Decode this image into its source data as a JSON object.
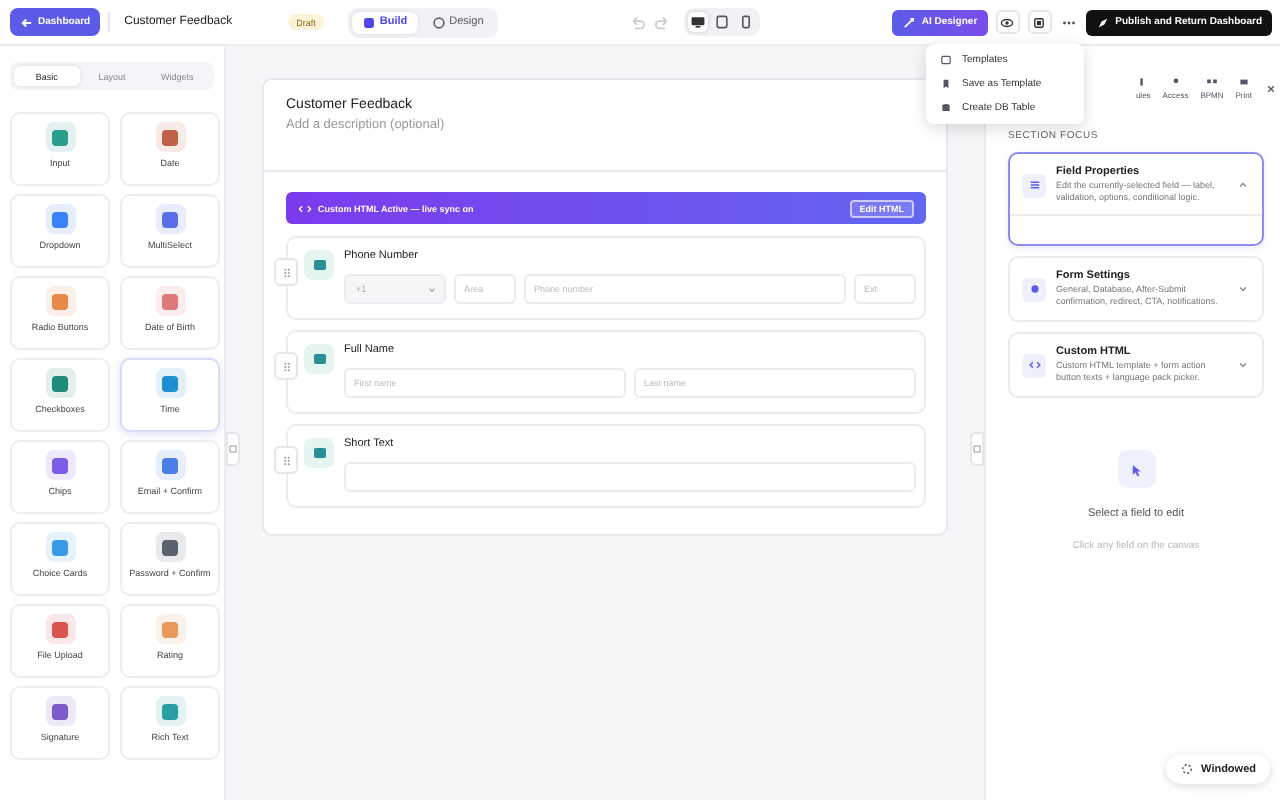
{
  "topbar": {
    "back_button": "Dashboard",
    "form_name": "Customer Feedback",
    "status_badge": "Draft",
    "modes": [
      {
        "kind": "build",
        "label": "Build",
        "selected": true
      },
      {
        "kind": "design",
        "label": "Design",
        "selected": false
      }
    ],
    "devices": [
      {
        "kind": "desktop",
        "selected": true
      },
      {
        "kind": "tablet",
        "selected": false
      },
      {
        "kind": "mobile",
        "selected": false
      }
    ],
    "ai_button": "AI Designer",
    "publish_button": "Publish and Return Dashboard"
  },
  "menu": {
    "items": [
      {
        "kind": "templates",
        "label": "Templates"
      },
      {
        "kind": "save",
        "label": "Save as Template"
      },
      {
        "kind": "database",
        "label": "Create DB Table"
      }
    ]
  },
  "palette": {
    "tabs": [
      {
        "label": "Basic",
        "selected": true
      },
      {
        "label": "Layout",
        "selected": false
      },
      {
        "label": "Widgets",
        "selected": false
      }
    ],
    "items": [
      {
        "label": "Input",
        "color": "#2a9d8f",
        "selected": false
      },
      {
        "label": "Date",
        "color": "#c0624a",
        "selected": false
      },
      {
        "label": "Dropdown",
        "color": "#3b82f6",
        "selected": false
      },
      {
        "label": "MultiSelect",
        "color": "#5b6ee8",
        "selected": false
      },
      {
        "label": "Radio Buttons",
        "color": "#e8894a",
        "selected": false
      },
      {
        "label": "Date of Birth",
        "color": "#e07a7a",
        "selected": false
      },
      {
        "label": "Checkboxes",
        "color": "#1f8a7a",
        "selected": false
      },
      {
        "label": "Time",
        "color": "#1e90d0",
        "selected": true
      },
      {
        "label": "Chips",
        "color": "#7c5ce8",
        "selected": false
      },
      {
        "label": "Email + Confirm",
        "color": "#4a7ee8",
        "selected": false
      },
      {
        "label": "Choice Cards",
        "color": "#3b9ae8",
        "selected": false
      },
      {
        "label": "Password + Confirm",
        "color": "#5a6270",
        "selected": false
      },
      {
        "label": "File Upload",
        "color": "#d9534f",
        "selected": false
      },
      {
        "label": "Rating",
        "color": "#e8995a",
        "selected": false
      },
      {
        "label": "Signature",
        "color": "#7c5cc8",
        "selected": false
      },
      {
        "label": "Rich Text",
        "color": "#2a9da0",
        "selected": false
      }
    ]
  },
  "form": {
    "title": "Customer Feedback",
    "description_placeholder": "Add a description (optional)",
    "banner": {
      "text": "Custom HTML Active — live sync on",
      "button": "Edit HTML"
    },
    "fields": [
      {
        "label": "Phone Number",
        "inputs": [
          {
            "kind": "select",
            "value": "+1"
          },
          {
            "kind": "short",
            "placeholder": "Area"
          },
          {
            "kind": "wide",
            "placeholder": "Phone number"
          },
          {
            "kind": "short",
            "placeholder": "Ext"
          }
        ]
      },
      {
        "label": "Full Name",
        "inputs": [
          {
            "kind": "wide",
            "placeholder": "First name"
          },
          {
            "kind": "wide",
            "placeholder": "Last name"
          }
        ]
      },
      {
        "label": "Short Text",
        "inputs": [
          {
            "kind": "wide"
          }
        ]
      }
    ]
  },
  "inspector": {
    "tabs": [
      {
        "kind": "rules",
        "label": "ules"
      },
      {
        "kind": "access",
        "label": "Access"
      },
      {
        "kind": "bpmn",
        "label": "BPMN"
      },
      {
        "kind": "print",
        "label": "Print"
      }
    ],
    "section_title": "SECTION FOCUS",
    "cards": [
      {
        "kind": "field",
        "title": "Field Properties",
        "description": "Edit the currently-selected field — label, validation, options, conditional logic.",
        "expanded": true
      },
      {
        "kind": "settings",
        "title": "Form Settings",
        "description": "General, Database, After-Submit confirmation, redirect, CTA, notifications.",
        "expanded": false
      },
      {
        "kind": "html",
        "title": "Custom HTML",
        "description": "Custom HTML template + form action button texts + language pack picker.",
        "expanded": false
      }
    ],
    "empty_state": {
      "title": "Select a field to edit",
      "hint": "Click any field on the canvas"
    }
  },
  "window_toggle": "Windowed"
}
